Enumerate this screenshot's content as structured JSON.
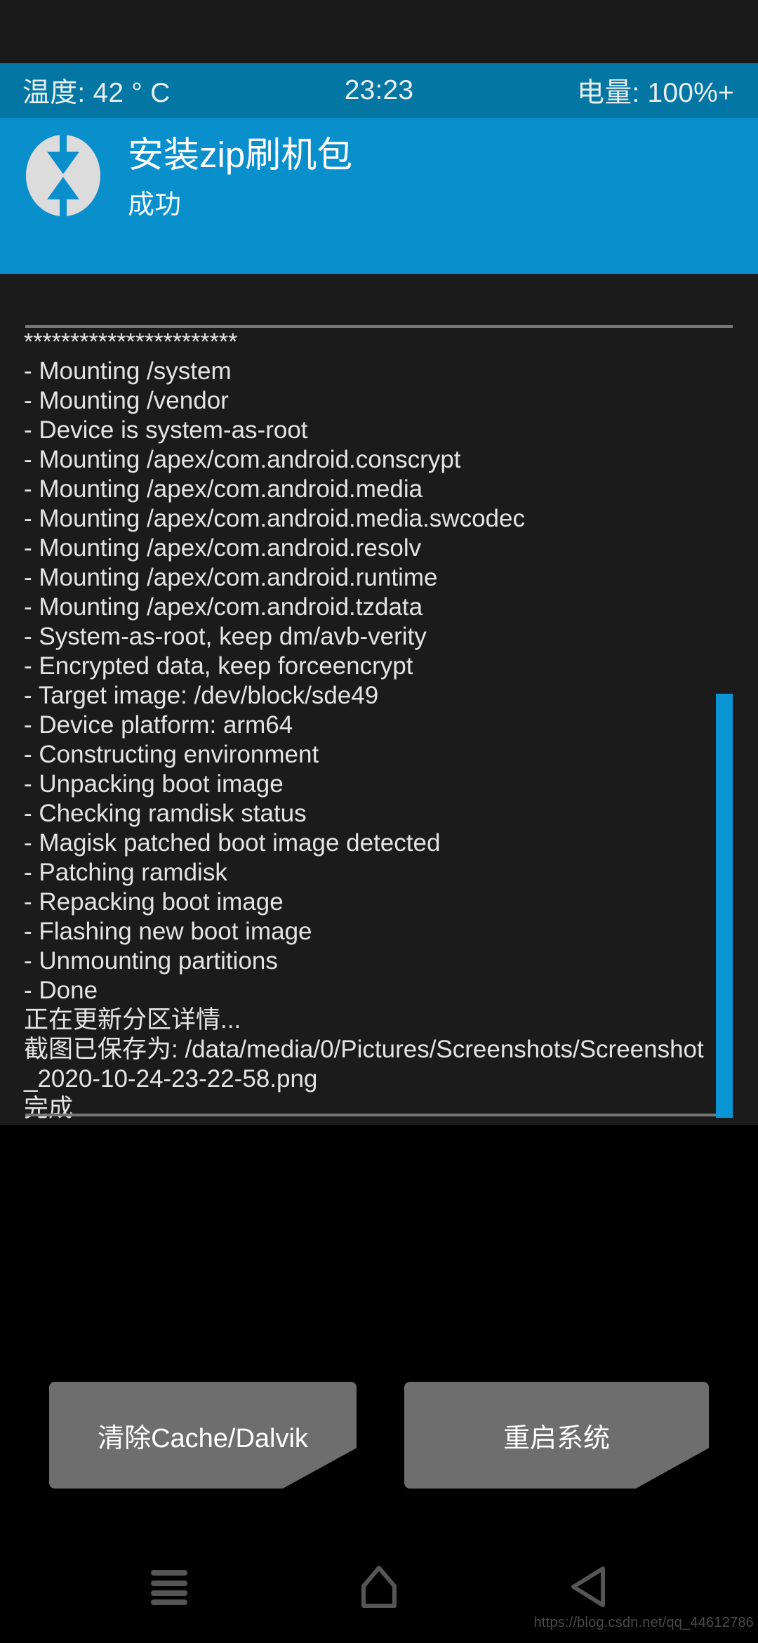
{
  "statusbar": {
    "temperature": "温度: 42 ° C",
    "clock": "23:23",
    "battery": "电量: 100%+"
  },
  "header": {
    "logo_icon": "twrp-logo-icon",
    "title": "安装zip刷机包",
    "subtitle": "成功",
    "accent_color": "#0a8fcd"
  },
  "console": {
    "lines": [
      "***********************",
      "- Mounting /system",
      "- Mounting /vendor",
      "- Device is system-as-root",
      "- Mounting /apex/com.android.conscrypt",
      "- Mounting /apex/com.android.media",
      "- Mounting /apex/com.android.media.swcodec",
      "- Mounting /apex/com.android.resolv",
      "- Mounting /apex/com.android.runtime",
      "- Mounting /apex/com.android.tzdata",
      "- System-as-root, keep dm/avb-verity",
      "- Encrypted data, keep forceencrypt",
      "- Target image: /dev/block/sde49",
      "- Device platform: arm64",
      "- Constructing environment",
      "- Unpacking boot image",
      "- Checking ramdisk status",
      "- Magisk patched boot image detected",
      "- Patching ramdisk",
      "- Repacking boot image",
      "- Flashing new boot image",
      "- Unmounting partitions",
      "- Done",
      "正在更新分区详情...",
      "截图已保存为: /data/media/0/Pictures/Screenshots/Screenshot_2020-10-24-23-22-58.png",
      "完成..."
    ],
    "scrollbar_color": "#0a96d4"
  },
  "buttons": {
    "wipe_cache_dalvik": "清除Cache/Dalvik",
    "reboot_system": "重启系统"
  },
  "navbar": {
    "recents_icon": "menu-icon",
    "home_icon": "home-icon",
    "back_icon": "back-triangle-icon"
  },
  "watermark": "https://blog.csdn.net/qq_44612786"
}
